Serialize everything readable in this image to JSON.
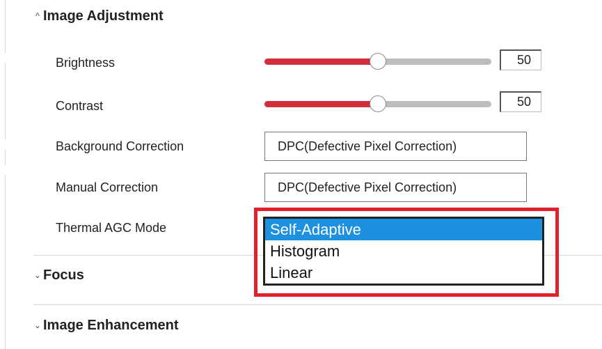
{
  "sections": {
    "image_adjustment": {
      "chevron": "^",
      "title": "Image Adjustment"
    },
    "focus": {
      "chevron": "v",
      "title": "Focus"
    },
    "image_enhancement": {
      "chevron": "v",
      "title": "Image Enhancement"
    }
  },
  "brightness": {
    "label": "Brightness",
    "value": "50",
    "level_percent": 50
  },
  "contrast": {
    "label": "Contrast",
    "value": "50",
    "level_percent": 50
  },
  "background_correction": {
    "label": "Background Correction",
    "value": "DPC(Defective Pixel Correction)"
  },
  "manual_correction": {
    "label": "Manual Correction",
    "value": "DPC(Defective Pixel Correction)"
  },
  "thermal_agc": {
    "label": "Thermal AGC Mode",
    "options": [
      "Self-Adaptive",
      "Histogram",
      "Linear"
    ],
    "selected": "Self-Adaptive"
  },
  "colors": {
    "slider_fill": "#d32f3a",
    "slider_track": "#bdbdbd",
    "highlight_frame": "#e0202a",
    "selected_option": "#1e90e0"
  }
}
